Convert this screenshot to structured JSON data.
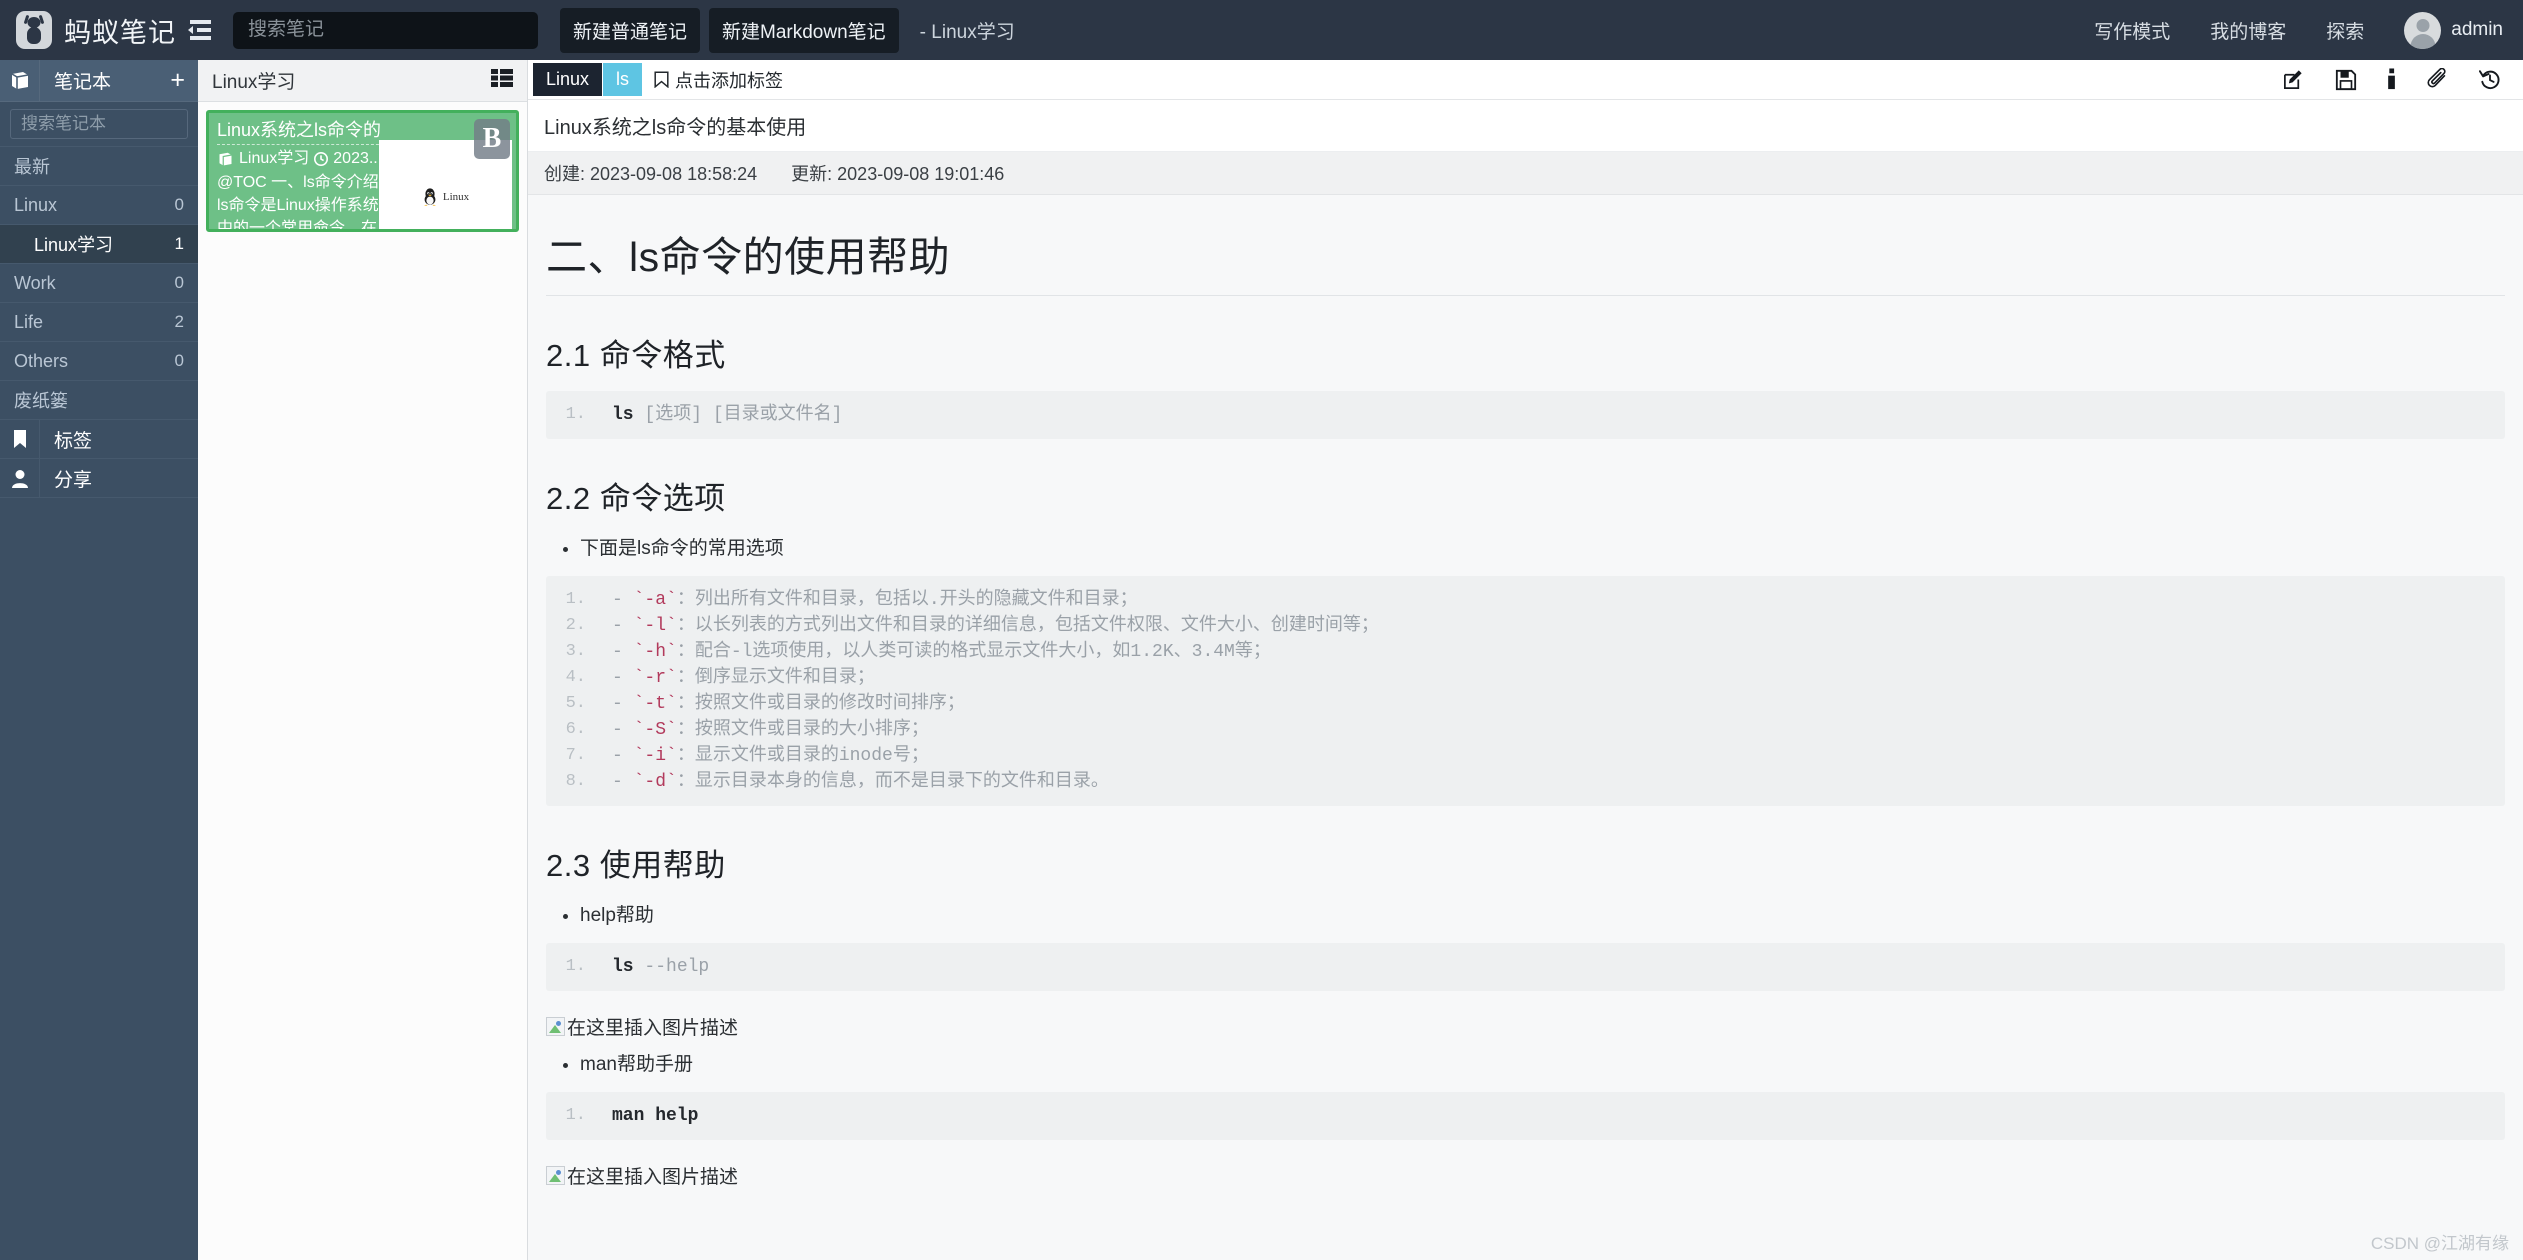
{
  "topbar": {
    "brand_name": "蚂蚁笔记",
    "indent_icon": "indent-list-icon",
    "search_placeholder": "搜索笔记",
    "search_value": "",
    "new_note_label": "新建普通笔记",
    "new_markdown_label": "新建Markdown笔记",
    "doc_title": "- Linux学习",
    "links": [
      {
        "label": "写作模式",
        "name": "writing-mode"
      },
      {
        "label": "我的博客",
        "name": "my-blog"
      },
      {
        "label": "探索",
        "name": "explore"
      }
    ],
    "user_name": "admin"
  },
  "sidebar": {
    "header": {
      "title": "笔记本",
      "icon": "notebook-icon",
      "add_label": "+"
    },
    "search_placeholder": "搜索笔记本",
    "items": [
      {
        "label": "最新",
        "count": "",
        "active": false,
        "sub": false
      },
      {
        "label": "Linux",
        "count": "0",
        "active": false,
        "sub": false
      },
      {
        "label": "Linux学习",
        "count": "1",
        "active": true,
        "sub": true
      },
      {
        "label": "Work",
        "count": "0",
        "active": false,
        "sub": false
      },
      {
        "label": "Life",
        "count": "2",
        "active": false,
        "sub": false
      },
      {
        "label": "Others",
        "count": "0",
        "active": false,
        "sub": false
      },
      {
        "label": "废纸篓",
        "count": "",
        "active": false,
        "sub": false
      }
    ],
    "footer": [
      {
        "label": "标签",
        "icon": "bookmark-icon"
      },
      {
        "label": "分享",
        "icon": "user-share-icon"
      }
    ]
  },
  "notelist": {
    "title": "Linux学习",
    "view_icon": "list-view-icon",
    "card": {
      "title": "Linux系统之ls命令的",
      "notebook": "Linux学习",
      "date": "2023...",
      "snippet_line1": "@TOC 一、ls命令介绍",
      "snippet_line2": "ls命令是Linux操作系统",
      "snippet_line3": "中的一个常用命令，在",
      "badge": "B",
      "thumb_label": "Linux"
    }
  },
  "notepane": {
    "tags": [
      {
        "label": "Linux",
        "style": "dark"
      },
      {
        "label": "ls",
        "style": "cyan"
      }
    ],
    "add_tag_label": "点击添加标签",
    "tools": [
      {
        "name": "edit-icon"
      },
      {
        "name": "save-icon"
      },
      {
        "name": "info-icon"
      },
      {
        "name": "attachment-icon"
      },
      {
        "name": "history-icon"
      }
    ],
    "note_title": "Linux系统之ls命令的基本使用",
    "created_label": "创建: 2023-09-08 18:58:24",
    "updated_label": "更新: 2023-09-08 19:01:46",
    "content": {
      "h1": "二、ls命令的使用帮助",
      "h2_1": "2.1 命令格式",
      "code1": {
        "num": "1.",
        "cmd": "ls",
        "args": " [选项] [目录或文件名]"
      },
      "h2_2": "2.2 命令选项",
      "bullet1": "下面是ls命令的常用选项",
      "options": [
        {
          "num": "1.",
          "flag": "`-a`",
          "desc": "：列出所有文件和目录，包括以.开头的隐藏文件和目录；"
        },
        {
          "num": "2.",
          "flag": "`-l`",
          "desc": "：以长列表的方式列出文件和目录的详细信息，包括文件权限、文件大小、创建时间等；"
        },
        {
          "num": "3.",
          "flag": "`-h`",
          "desc": "：配合-l选项使用，以人类可读的格式显示文件大小，如1.2K、3.4M等；"
        },
        {
          "num": "4.",
          "flag": "`-r`",
          "desc": "：倒序显示文件和目录；"
        },
        {
          "num": "5.",
          "flag": "`-t`",
          "desc": "：按照文件或目录的修改时间排序；"
        },
        {
          "num": "6.",
          "flag": "`-S`",
          "desc": "：按照文件或目录的大小排序；"
        },
        {
          "num": "7.",
          "flag": "`-i`",
          "desc": "：显示文件或目录的inode号；"
        },
        {
          "num": "8.",
          "flag": "`-d`",
          "desc": "：显示目录本身的信息，而不是目录下的文件和目录。"
        }
      ],
      "h2_3": "2.3 使用帮助",
      "bullet2": "help帮助",
      "code2": {
        "num": "1.",
        "cmd": "ls",
        "args": " --help"
      },
      "img_alt_1": "在这里插入图片描述",
      "bullet3": "man帮助手册",
      "code3": {
        "num": "1.",
        "cmd": "man help",
        "args": ""
      },
      "img_alt_2": "在这里插入图片描述"
    },
    "watermark": "CSDN @江湖有缘"
  }
}
